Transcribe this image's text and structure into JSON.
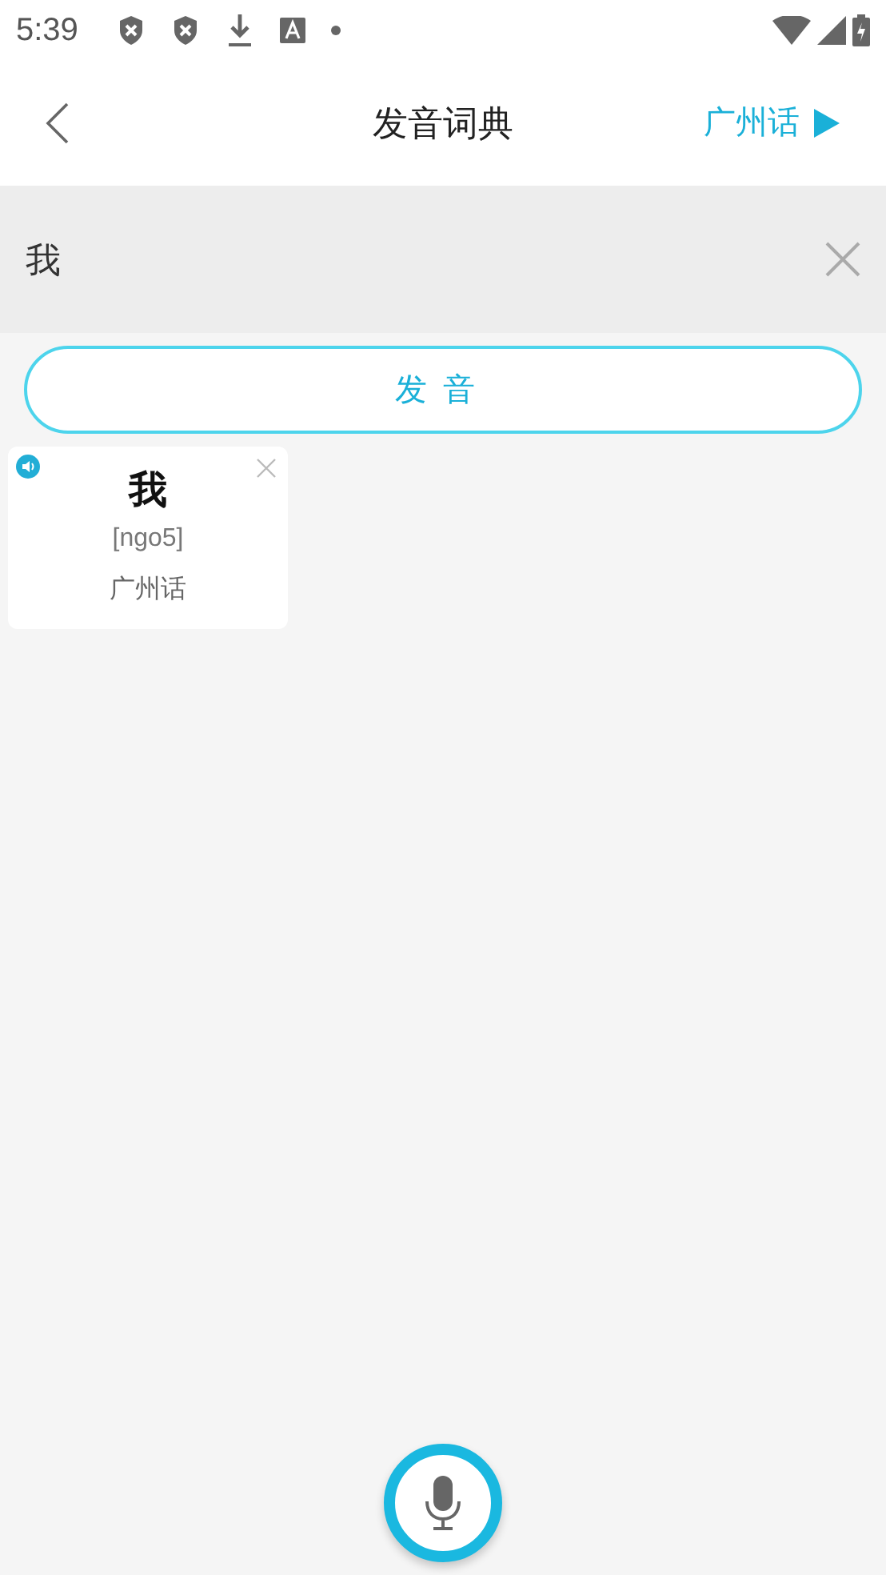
{
  "status_bar": {
    "time": "5:39"
  },
  "header": {
    "title": "发音词典",
    "language": "广州话"
  },
  "search": {
    "value": "我"
  },
  "pronounce_button": "发音",
  "results": [
    {
      "character": "我",
      "romanization": "[ngo5]",
      "language": "广州话"
    }
  ]
}
